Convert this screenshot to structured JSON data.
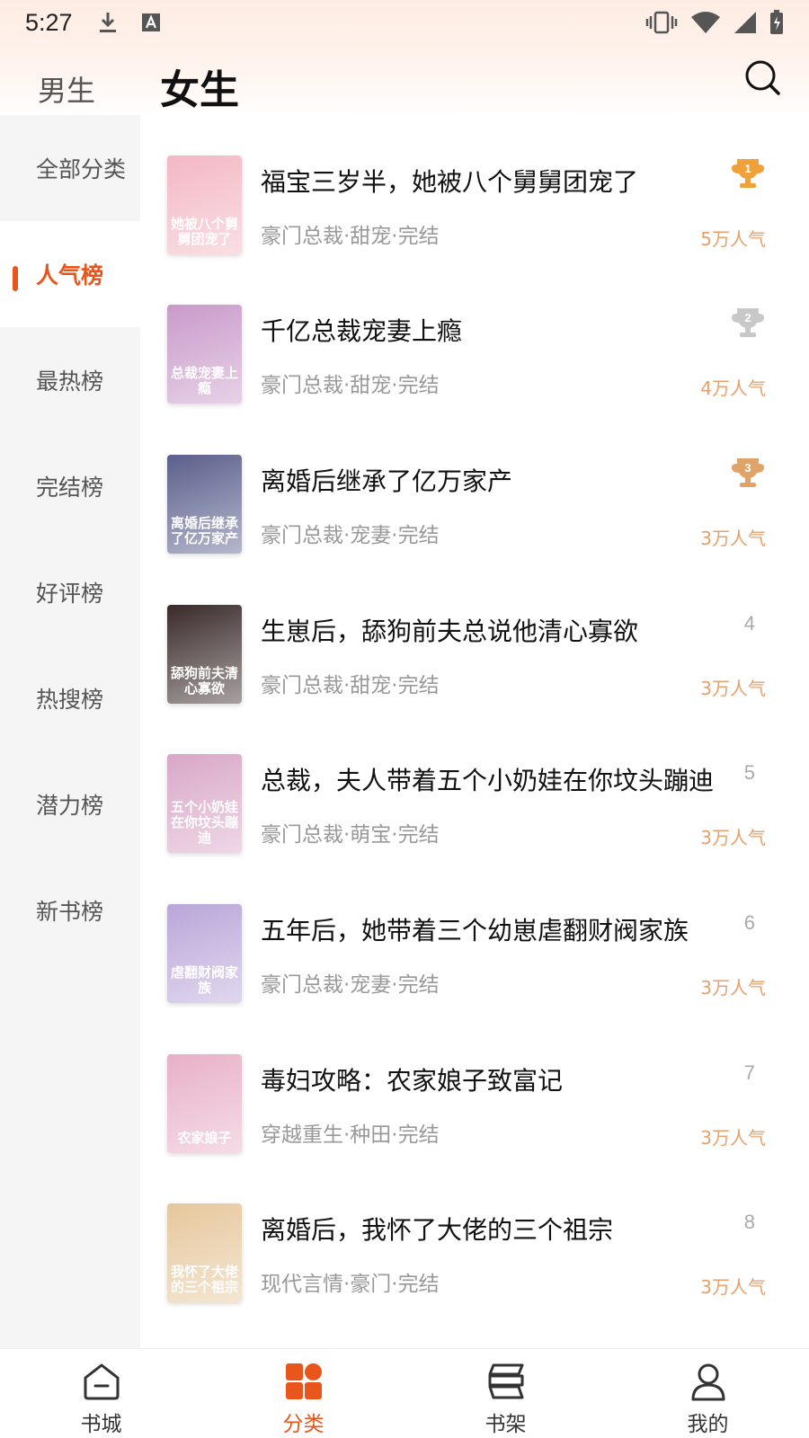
{
  "status_bar": {
    "time": "5:27",
    "icons": [
      "download-icon",
      "font-icon",
      "vibrate-icon",
      "wifi-icon",
      "signal-icon",
      "battery-icon"
    ]
  },
  "header": {
    "tab_male": "男生",
    "tab_female": "女生"
  },
  "sidebar": {
    "items": [
      {
        "label": "全部分类"
      },
      {
        "label": "人气榜"
      },
      {
        "label": "最热榜"
      },
      {
        "label": "完结榜"
      },
      {
        "label": "好评榜"
      },
      {
        "label": "热搜榜"
      },
      {
        "label": "潜力榜"
      },
      {
        "label": "新书榜"
      }
    ],
    "active_index": 1
  },
  "books": [
    {
      "title": "福宝三岁半，她被八个舅舅团宠了",
      "tags": "豪门总裁·甜宠·完结",
      "popularity": "5万人气",
      "rank": "1",
      "cover_text": "她被八个舅舅团宠了",
      "cover_color": "#f3b7c4"
    },
    {
      "title": "千亿总裁宠妻上瘾",
      "tags": "豪门总裁·甜宠·完结",
      "popularity": "4万人气",
      "rank": "2",
      "cover_text": "总裁宠妻上瘾",
      "cover_color": "#c99ac9"
    },
    {
      "title": "离婚后继承了亿万家产",
      "tags": "豪门总裁·宠妻·完结",
      "popularity": "3万人气",
      "rank": "3",
      "cover_text": "离婚后继承了亿万家产",
      "cover_color": "#5a5f8c"
    },
    {
      "title": "生崽后，舔狗前夫总说他清心寡欲",
      "tags": "豪门总裁·甜宠·完结",
      "popularity": "3万人气",
      "rank": "4",
      "cover_text": "舔狗前夫清心寡欲",
      "cover_color": "#3a2a2a"
    },
    {
      "title": "总裁，夫人带着五个小奶娃在你坟头蹦迪",
      "tags": "豪门总裁·萌宝·完结",
      "popularity": "3万人气",
      "rank": "5",
      "cover_text": "五个小奶娃在你坟头蹦迪",
      "cover_color": "#d9a7c7"
    },
    {
      "title": "五年后，她带着三个幼崽虐翻财阀家族",
      "tags": "豪门总裁·宠妻·完结",
      "popularity": "3万人气",
      "rank": "6",
      "cover_text": "虐翻财阀家族",
      "cover_color": "#b9a6d9"
    },
    {
      "title": "毒妇攻略：农家娘子致富记",
      "tags": "穿越重生·种田·完结",
      "popularity": "3万人气",
      "rank": "7",
      "cover_text": "农家娘子",
      "cover_color": "#e8b0c8"
    },
    {
      "title": "离婚后，我怀了大佬的三个祖宗",
      "tags": "现代言情·豪门·完结",
      "popularity": "3万人气",
      "rank": "8",
      "cover_text": "我怀了大佬的三个祖宗",
      "cover_color": "#e6c79c"
    }
  ],
  "bottom_nav": [
    {
      "label": "书城",
      "icon": "home-icon"
    },
    {
      "label": "分类",
      "icon": "category-icon"
    },
    {
      "label": "书架",
      "icon": "bookshelf-icon"
    },
    {
      "label": "我的",
      "icon": "profile-icon"
    }
  ],
  "bottom_nav_active": 1,
  "colors": {
    "accent": "#e8561c",
    "popularity": "#e8a06a",
    "gold": "#f0a13a",
    "silver": "#c8c8c8",
    "bronze": "#e0a36a"
  }
}
